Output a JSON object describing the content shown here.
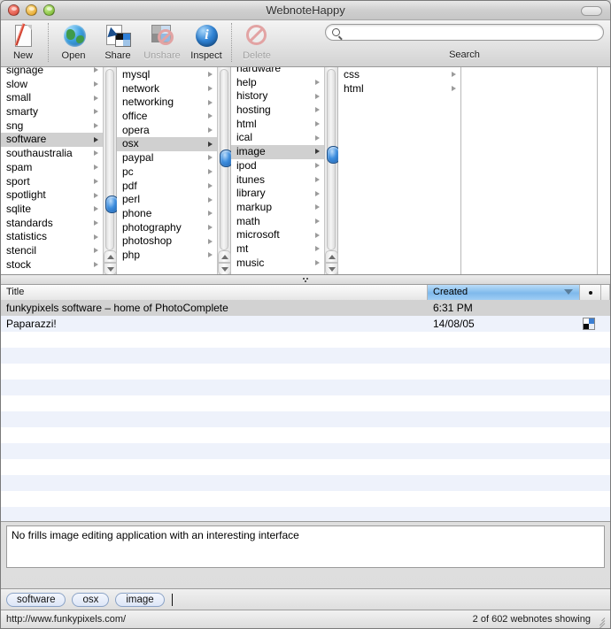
{
  "window": {
    "title": "WebnoteHappy",
    "controls": [
      "close",
      "minimize",
      "zoom"
    ],
    "toolbar_toggle": "toolbar-pill"
  },
  "toolbar": {
    "items": [
      {
        "label": "New",
        "icon": "new-document-icon",
        "enabled": true
      },
      {
        "label": "Open",
        "icon": "globe-icon",
        "enabled": true
      },
      {
        "label": "Share",
        "icon": "share-icon",
        "enabled": true
      },
      {
        "label": "Unshare",
        "icon": "unshare-icon",
        "enabled": false
      },
      {
        "label": "Inspect",
        "icon": "info-icon",
        "enabled": true
      },
      {
        "label": "Delete",
        "icon": "delete-icon",
        "enabled": false
      }
    ],
    "search": {
      "label": "Search",
      "value": "",
      "placeholder": "",
      "icon": "search-icon"
    }
  },
  "browser": {
    "columns": [
      {
        "name": "column-1",
        "items": [
          {
            "label": "signage",
            "has_children": true,
            "selected": false
          },
          {
            "label": "slow",
            "has_children": true,
            "selected": false
          },
          {
            "label": "small",
            "has_children": true,
            "selected": false
          },
          {
            "label": "smarty",
            "has_children": true,
            "selected": false
          },
          {
            "label": "sng",
            "has_children": true,
            "selected": false
          },
          {
            "label": "software",
            "has_children": true,
            "selected": true
          },
          {
            "label": "southaustralia",
            "has_children": true,
            "selected": false
          },
          {
            "label": "spam",
            "has_children": true,
            "selected": false
          },
          {
            "label": "sport",
            "has_children": true,
            "selected": false
          },
          {
            "label": "spotlight",
            "has_children": true,
            "selected": false
          },
          {
            "label": "sqlite",
            "has_children": true,
            "selected": false
          },
          {
            "label": "standards",
            "has_children": true,
            "selected": false
          },
          {
            "label": "statistics",
            "has_children": true,
            "selected": false
          },
          {
            "label": "stencil",
            "has_children": true,
            "selected": false
          },
          {
            "label": "stock",
            "has_children": true,
            "selected": false
          }
        ]
      },
      {
        "name": "column-2",
        "items": [
          {
            "label": "mysql",
            "has_children": true,
            "selected": false
          },
          {
            "label": "network",
            "has_children": true,
            "selected": false
          },
          {
            "label": "networking",
            "has_children": true,
            "selected": false
          },
          {
            "label": "office",
            "has_children": true,
            "selected": false
          },
          {
            "label": "opera",
            "has_children": true,
            "selected": false
          },
          {
            "label": "osx",
            "has_children": true,
            "selected": true
          },
          {
            "label": "paypal",
            "has_children": true,
            "selected": false
          },
          {
            "label": "pc",
            "has_children": true,
            "selected": false
          },
          {
            "label": "pdf",
            "has_children": true,
            "selected": false
          },
          {
            "label": "perl",
            "has_children": true,
            "selected": false
          },
          {
            "label": "phone",
            "has_children": true,
            "selected": false
          },
          {
            "label": "photography",
            "has_children": true,
            "selected": false
          },
          {
            "label": "photoshop",
            "has_children": true,
            "selected": false
          },
          {
            "label": "php",
            "has_children": true,
            "selected": false
          }
        ]
      },
      {
        "name": "column-3",
        "items": [
          {
            "label": "hardware",
            "has_children": false,
            "selected": false
          },
          {
            "label": "help",
            "has_children": true,
            "selected": false
          },
          {
            "label": "history",
            "has_children": true,
            "selected": false
          },
          {
            "label": "hosting",
            "has_children": true,
            "selected": false
          },
          {
            "label": "html",
            "has_children": true,
            "selected": false
          },
          {
            "label": "ical",
            "has_children": true,
            "selected": false
          },
          {
            "label": "image",
            "has_children": true,
            "selected": true
          },
          {
            "label": "ipod",
            "has_children": true,
            "selected": false
          },
          {
            "label": "itunes",
            "has_children": true,
            "selected": false
          },
          {
            "label": "library",
            "has_children": true,
            "selected": false
          },
          {
            "label": "markup",
            "has_children": true,
            "selected": false
          },
          {
            "label": "math",
            "has_children": true,
            "selected": false
          },
          {
            "label": "microsoft",
            "has_children": true,
            "selected": false
          },
          {
            "label": "mt",
            "has_children": true,
            "selected": false
          },
          {
            "label": "music",
            "has_children": true,
            "selected": false
          }
        ]
      },
      {
        "name": "column-4",
        "items": [
          {
            "label": "css",
            "has_children": true,
            "selected": false
          },
          {
            "label": "html",
            "has_children": true,
            "selected": false
          }
        ]
      },
      {
        "name": "column-5",
        "items": []
      }
    ]
  },
  "table": {
    "columns": [
      {
        "label": "Title",
        "active": false
      },
      {
        "label": "Created",
        "active": true,
        "sort": "descending"
      },
      {
        "label": "",
        "active": false,
        "icon": "dot-icon"
      }
    ],
    "rows": [
      {
        "title": "funkypixels software – home of PhotoComplete",
        "created": "6:31 PM",
        "selected": true,
        "favicon": false
      },
      {
        "title": "Paparazzi!",
        "created": "14/08/05",
        "selected": false,
        "favicon": true
      }
    ],
    "empty_row_count": 13
  },
  "notes": {
    "text": "No frills image editing application with an interesting interface"
  },
  "tags": {
    "items": [
      "software",
      "osx",
      "image"
    ],
    "input_value": ""
  },
  "status": {
    "url": "http://www.funkypixels.com/",
    "count_text": "2 of 602 webnotes showing"
  },
  "colors": {
    "accent_blue": "#3e8ede",
    "selection_gray": "#d2d2d2",
    "alt_row": "#eef2fb",
    "header_active": "#7fb9ec"
  }
}
